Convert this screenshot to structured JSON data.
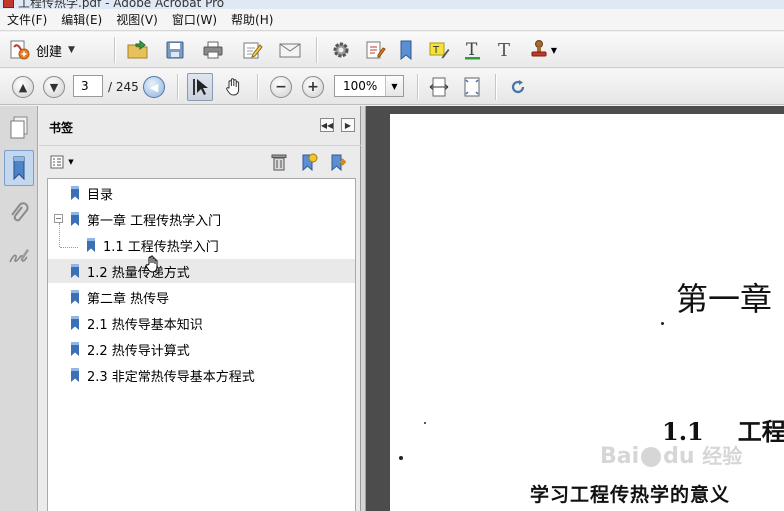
{
  "window": {
    "title": "工程传热学.pdf - Adobe Acrobat Pro"
  },
  "menu": [
    "文件(F)",
    "编辑(E)",
    "视图(V)",
    "窗口(W)",
    "帮助(H)"
  ],
  "toolbar": {
    "create_label": "创建",
    "icons": [
      "open-folder-icon",
      "save-icon",
      "print-icon",
      "edit-icon",
      "email-icon",
      "settings-icon",
      "comment-edit-icon",
      "bookmark-icon",
      "highlight-text-icon",
      "underline-text-icon",
      "text-icon",
      "stamp-icon"
    ]
  },
  "nav": {
    "current_page": "3",
    "total_pages": "/ 245",
    "zoom": "100%"
  },
  "panel": {
    "title": "书签",
    "bookmarks": [
      {
        "label": "目录",
        "level": 0
      },
      {
        "label": "第一章 工程传热学入门",
        "level": 0,
        "expanded": true
      },
      {
        "label": "1.1 工程传热学入门",
        "level": 1
      },
      {
        "label": "1.2 热量传递方式",
        "level": 0,
        "hover": true
      },
      {
        "label": "第二章 热传导",
        "level": 0
      },
      {
        "label": "2.1 热传导基本知识",
        "level": 0
      },
      {
        "label": "2.2 热传导计算式",
        "level": 0
      },
      {
        "label": "2.3 非定常热传导基本方程式",
        "level": 0
      }
    ]
  },
  "document": {
    "chapter_heading": "第一章",
    "section_number": "1.1",
    "section_title": "工程",
    "subsection_title": "学习工程传热学的意义"
  },
  "watermark": {
    "text_latin": "Bai",
    "text_latin2": "du",
    "text_cn": "经验"
  },
  "colors": {
    "accent": "#2b5797",
    "bookmark_icon": "#3b6fb6",
    "doc_bg": "#4c4c4c"
  }
}
